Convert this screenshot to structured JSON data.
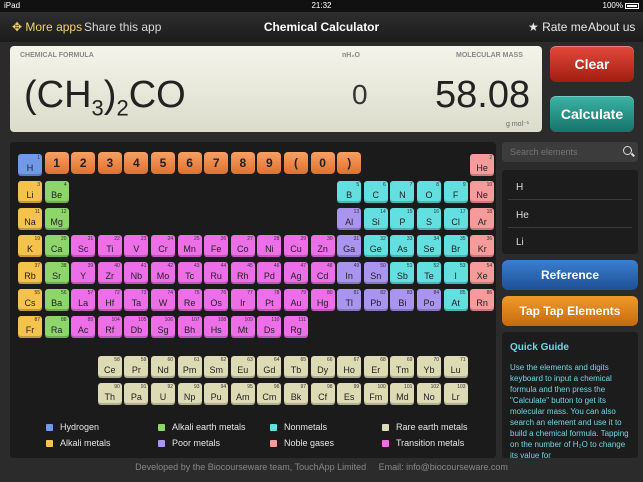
{
  "status": {
    "device": "iPad",
    "time": "21:32",
    "battery": "100%"
  },
  "nav": {
    "more": "More apps",
    "share": "Share this app",
    "title": "Chemical Calculator",
    "rate": "Rate me",
    "about": "About us"
  },
  "display": {
    "formula_label": "CHEMICAL FORMULA",
    "nh2o_label": "nH₂O",
    "mass_label": "MOLECULAR MASS",
    "formula_a": "(CH",
    "formula_sub1": "3",
    "formula_b": ")",
    "formula_sub2": "2",
    "formula_c": "CO",
    "nh2o_value": "0",
    "mass_value": "58.08",
    "unit": "g mol⁻¹"
  },
  "buttons": {
    "clear": "Clear",
    "calculate": "Calculate",
    "reference": "Reference",
    "taptap": "Tap Tap Elements"
  },
  "keypad": [
    "1",
    "2",
    "3",
    "4",
    "5",
    "6",
    "7",
    "8",
    "9",
    "(",
    "0",
    ")"
  ],
  "colors": {
    "h": "#6f9ae8",
    "alkali": "#f4c24d",
    "alkaline": "#8ed66b",
    "metal": "#ec6fe7",
    "nonmetal": "#63dfe0",
    "poor": "#a995ee",
    "noble": "#f59b9b",
    "rare": "#dcdbb4"
  },
  "elements": [
    {
      "n": "1",
      "s": "H",
      "c": "h"
    },
    {
      "n": "2",
      "s": "He",
      "c": "noble"
    },
    {
      "n": "3",
      "s": "Li",
      "c": "alkali"
    },
    {
      "n": "4",
      "s": "Be",
      "c": "alkaline"
    },
    {
      "n": "5",
      "s": "B",
      "c": "nonmetal"
    },
    {
      "n": "6",
      "s": "C",
      "c": "nonmetal"
    },
    {
      "n": "7",
      "s": "N",
      "c": "nonmetal"
    },
    {
      "n": "8",
      "s": "O",
      "c": "nonmetal"
    },
    {
      "n": "9",
      "s": "F",
      "c": "nonmetal"
    },
    {
      "n": "10",
      "s": "Ne",
      "c": "noble"
    },
    {
      "n": "11",
      "s": "Na",
      "c": "alkali"
    },
    {
      "n": "12",
      "s": "Mg",
      "c": "alkaline"
    },
    {
      "n": "13",
      "s": "Al",
      "c": "poor"
    },
    {
      "n": "14",
      "s": "Si",
      "c": "nonmetal"
    },
    {
      "n": "15",
      "s": "P",
      "c": "nonmetal"
    },
    {
      "n": "16",
      "s": "S",
      "c": "nonmetal"
    },
    {
      "n": "17",
      "s": "Cl",
      "c": "nonmetal"
    },
    {
      "n": "18",
      "s": "Ar",
      "c": "noble"
    },
    {
      "n": "19",
      "s": "K",
      "c": "alkali"
    },
    {
      "n": "20",
      "s": "Ca",
      "c": "alkaline"
    },
    {
      "n": "21",
      "s": "Sc",
      "c": "metal"
    },
    {
      "n": "22",
      "s": "Ti",
      "c": "metal"
    },
    {
      "n": "23",
      "s": "V",
      "c": "metal"
    },
    {
      "n": "24",
      "s": "Cr",
      "c": "metal"
    },
    {
      "n": "25",
      "s": "Mn",
      "c": "metal"
    },
    {
      "n": "26",
      "s": "Fe",
      "c": "metal"
    },
    {
      "n": "27",
      "s": "Co",
      "c": "metal"
    },
    {
      "n": "28",
      "s": "Ni",
      "c": "metal"
    },
    {
      "n": "29",
      "s": "Cu",
      "c": "metal"
    },
    {
      "n": "30",
      "s": "Zn",
      "c": "metal"
    },
    {
      "n": "31",
      "s": "Ga",
      "c": "poor"
    },
    {
      "n": "32",
      "s": "Ge",
      "c": "nonmetal"
    },
    {
      "n": "33",
      "s": "As",
      "c": "nonmetal"
    },
    {
      "n": "34",
      "s": "Se",
      "c": "nonmetal"
    },
    {
      "n": "35",
      "s": "Br",
      "c": "nonmetal"
    },
    {
      "n": "36",
      "s": "Kr",
      "c": "noble"
    },
    {
      "n": "37",
      "s": "Rb",
      "c": "alkali"
    },
    {
      "n": "38",
      "s": "Sr",
      "c": "alkaline"
    },
    {
      "n": "39",
      "s": "Y",
      "c": "metal"
    },
    {
      "n": "40",
      "s": "Zr",
      "c": "metal"
    },
    {
      "n": "41",
      "s": "Nb",
      "c": "metal"
    },
    {
      "n": "42",
      "s": "Mo",
      "c": "metal"
    },
    {
      "n": "43",
      "s": "Tc",
      "c": "metal"
    },
    {
      "n": "44",
      "s": "Ru",
      "c": "metal"
    },
    {
      "n": "45",
      "s": "Rh",
      "c": "metal"
    },
    {
      "n": "46",
      "s": "Pd",
      "c": "metal"
    },
    {
      "n": "47",
      "s": "Ag",
      "c": "metal"
    },
    {
      "n": "48",
      "s": "Cd",
      "c": "metal"
    },
    {
      "n": "49",
      "s": "In",
      "c": "poor"
    },
    {
      "n": "50",
      "s": "Sn",
      "c": "poor"
    },
    {
      "n": "51",
      "s": "Sb",
      "c": "nonmetal"
    },
    {
      "n": "52",
      "s": "Te",
      "c": "nonmetal"
    },
    {
      "n": "53",
      "s": "I",
      "c": "nonmetal"
    },
    {
      "n": "54",
      "s": "Xe",
      "c": "noble"
    },
    {
      "n": "55",
      "s": "Cs",
      "c": "alkali"
    },
    {
      "n": "56",
      "s": "Ba",
      "c": "alkaline"
    },
    {
      "n": "57",
      "s": "La",
      "c": "metal"
    },
    {
      "n": "72",
      "s": "Hf",
      "c": "metal"
    },
    {
      "n": "73",
      "s": "Ta",
      "c": "metal"
    },
    {
      "n": "74",
      "s": "W",
      "c": "metal"
    },
    {
      "n": "75",
      "s": "Re",
      "c": "metal"
    },
    {
      "n": "76",
      "s": "Os",
      "c": "metal"
    },
    {
      "n": "77",
      "s": "Ir",
      "c": "metal"
    },
    {
      "n": "78",
      "s": "Pt",
      "c": "metal"
    },
    {
      "n": "79",
      "s": "Au",
      "c": "metal"
    },
    {
      "n": "80",
      "s": "Hg",
      "c": "metal"
    },
    {
      "n": "81",
      "s": "Tl",
      "c": "poor"
    },
    {
      "n": "82",
      "s": "Pb",
      "c": "poor"
    },
    {
      "n": "83",
      "s": "Bi",
      "c": "poor"
    },
    {
      "n": "84",
      "s": "Po",
      "c": "poor"
    },
    {
      "n": "85",
      "s": "At",
      "c": "nonmetal"
    },
    {
      "n": "86",
      "s": "Rn",
      "c": "noble"
    },
    {
      "n": "87",
      "s": "Fr",
      "c": "alkali"
    },
    {
      "n": "88",
      "s": "Ra",
      "c": "alkaline"
    },
    {
      "n": "89",
      "s": "Ac",
      "c": "metal"
    },
    {
      "n": "104",
      "s": "Rf",
      "c": "metal"
    },
    {
      "n": "105",
      "s": "Db",
      "c": "metal"
    },
    {
      "n": "106",
      "s": "Sg",
      "c": "metal"
    },
    {
      "n": "107",
      "s": "Bh",
      "c": "metal"
    },
    {
      "n": "108",
      "s": "Hs",
      "c": "metal"
    },
    {
      "n": "109",
      "s": "Mt",
      "c": "metal"
    },
    {
      "n": "110",
      "s": "Ds",
      "c": "metal"
    },
    {
      "n": "111",
      "s": "Rg",
      "c": "metal"
    },
    {
      "n": "58",
      "s": "Ce",
      "c": "rare"
    },
    {
      "n": "59",
      "s": "Pr",
      "c": "rare"
    },
    {
      "n": "60",
      "s": "Nd",
      "c": "rare"
    },
    {
      "n": "61",
      "s": "Pm",
      "c": "rare"
    },
    {
      "n": "62",
      "s": "Sm",
      "c": "rare"
    },
    {
      "n": "63",
      "s": "Eu",
      "c": "rare"
    },
    {
      "n": "64",
      "s": "Gd",
      "c": "rare"
    },
    {
      "n": "65",
      "s": "Tb",
      "c": "rare"
    },
    {
      "n": "66",
      "s": "Dy",
      "c": "rare"
    },
    {
      "n": "67",
      "s": "Ho",
      "c": "rare"
    },
    {
      "n": "68",
      "s": "Er",
      "c": "rare"
    },
    {
      "n": "69",
      "s": "Tm",
      "c": "rare"
    },
    {
      "n": "70",
      "s": "Yb",
      "c": "rare"
    },
    {
      "n": "71",
      "s": "Lu",
      "c": "rare"
    },
    {
      "n": "90",
      "s": "Th",
      "c": "rare"
    },
    {
      "n": "91",
      "s": "Pa",
      "c": "rare"
    },
    {
      "n": "92",
      "s": "U",
      "c": "rare"
    },
    {
      "n": "93",
      "s": "Np",
      "c": "rare"
    },
    {
      "n": "94",
      "s": "Pu",
      "c": "rare"
    },
    {
      "n": "95",
      "s": "Am",
      "c": "rare"
    },
    {
      "n": "96",
      "s": "Cm",
      "c": "rare"
    },
    {
      "n": "97",
      "s": "Bk",
      "c": "rare"
    },
    {
      "n": "98",
      "s": "Cf",
      "c": "rare"
    },
    {
      "n": "99",
      "s": "Es",
      "c": "rare"
    },
    {
      "n": "100",
      "s": "Fm",
      "c": "rare"
    },
    {
      "n": "101",
      "s": "Md",
      "c": "rare"
    },
    {
      "n": "102",
      "s": "No",
      "c": "rare"
    },
    {
      "n": "103",
      "s": "Lr",
      "c": "rare"
    }
  ],
  "legend": [
    {
      "label": "Hydrogen",
      "c": "h"
    },
    {
      "label": "Alkali earth metals",
      "c": "alkaline"
    },
    {
      "label": "Nonmetals",
      "c": "nonmetal"
    },
    {
      "label": "Rare earth metals",
      "c": "rare"
    },
    {
      "label": "Alkali metals",
      "c": "alkali"
    },
    {
      "label": "Poor metals",
      "c": "poor"
    },
    {
      "label": "Noble gases",
      "c": "noble"
    },
    {
      "label": "Transition metals",
      "c": "metal"
    }
  ],
  "search": {
    "placeholder": "Search elements"
  },
  "results": [
    "H",
    "He",
    "Li"
  ],
  "guide": {
    "title": "Quick Guide",
    "body": "Use the elements and digits keyboard to input a chemical formula and then press the \"Calculate\" button to get its molecular mass. You can also search an element and use it to build a chemical formula. Tapping on the number of H₂O to change its value for"
  },
  "footer": {
    "dev": "Developed by the Biocourseware team, TouchApp Limited",
    "email": "Email: info@biocourseware.com"
  }
}
